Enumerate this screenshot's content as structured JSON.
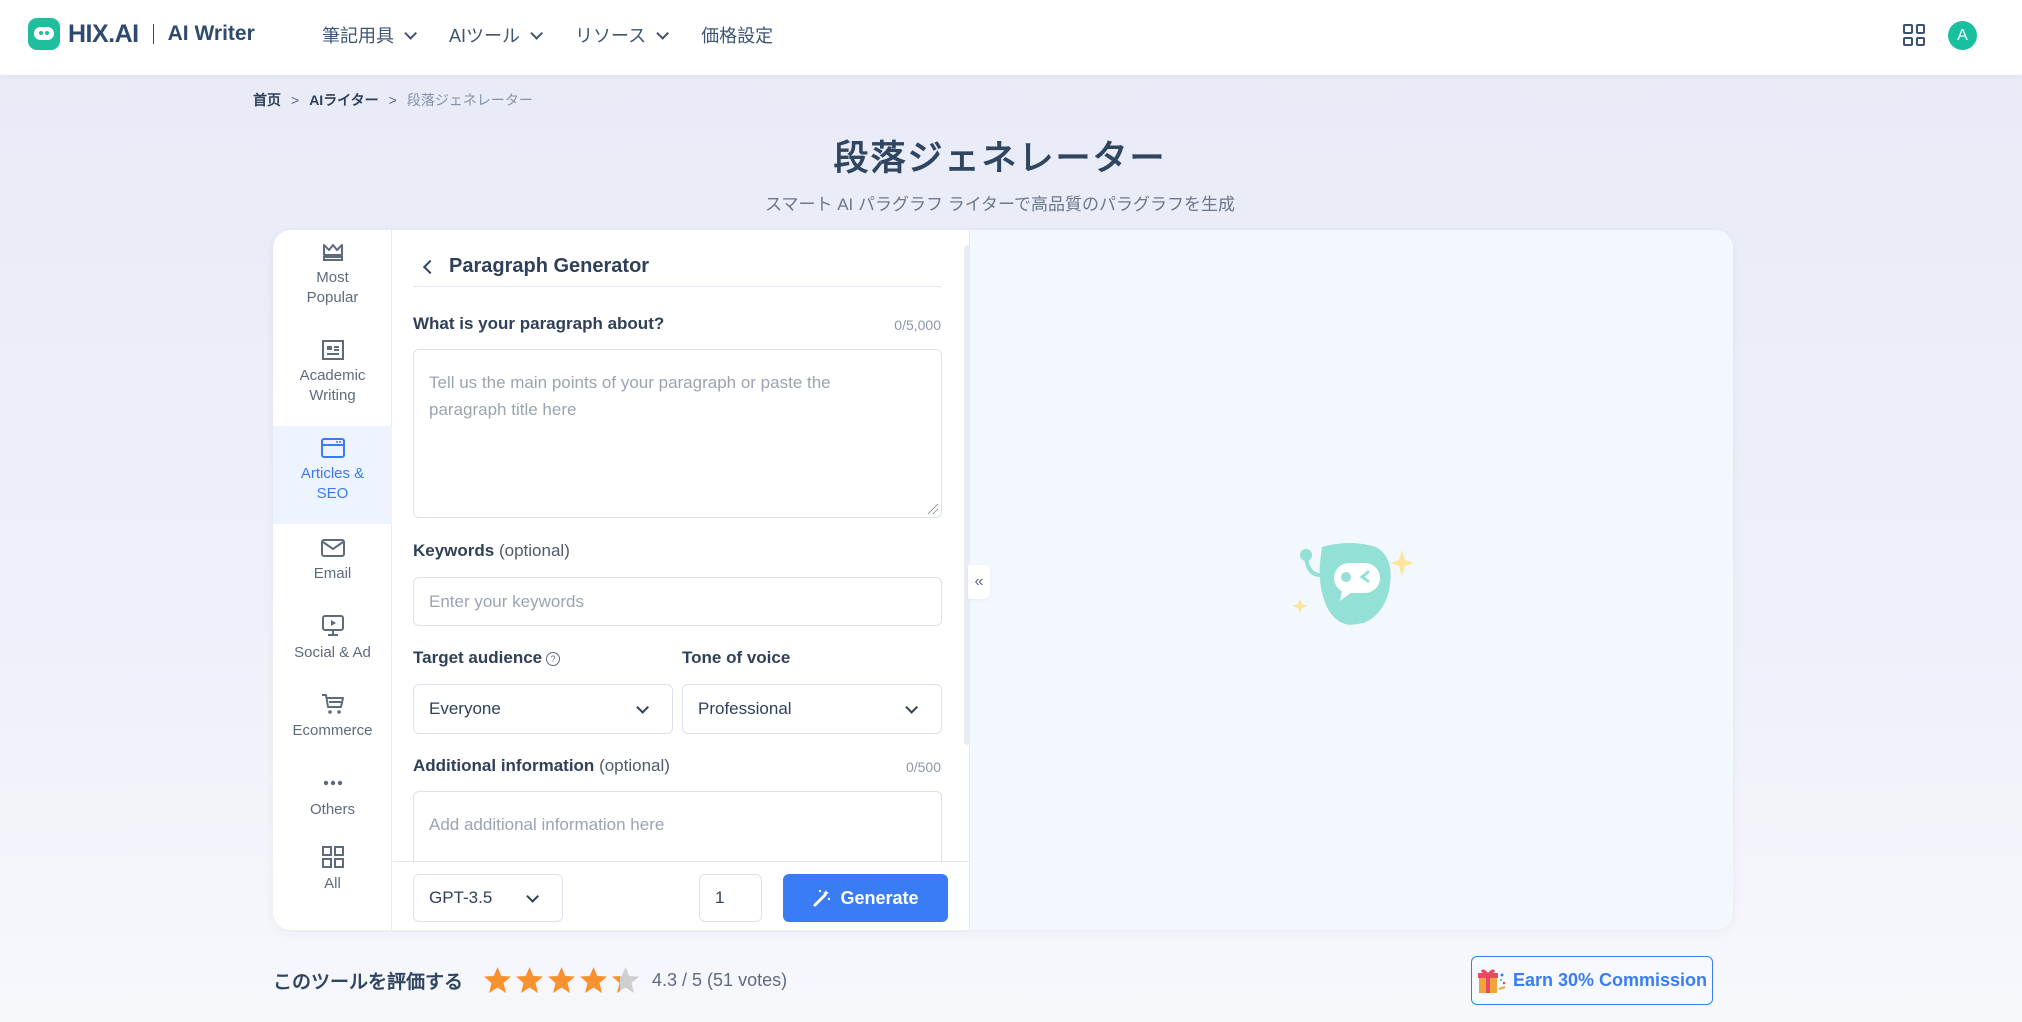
{
  "header": {
    "brand": "HIX.AI",
    "product": "AI Writer",
    "nav": [
      {
        "label": "筆記用具",
        "has_dropdown": true
      },
      {
        "label": "AIツール",
        "has_dropdown": true
      },
      {
        "label": "リソース",
        "has_dropdown": true
      },
      {
        "label": "価格設定",
        "has_dropdown": false
      }
    ],
    "apps_icon": "grid-icon",
    "avatar_letter": "A",
    "accent_color": "#18c09f"
  },
  "breadcrumb": {
    "items": [
      "首页",
      "AIライター",
      "段落ジェネレーター"
    ],
    "separator": ">"
  },
  "page": {
    "title": "段落ジェネレーター",
    "subtitle": "スマート AI パラグラフ ライターで高品質のパラグラフを生成"
  },
  "sidebar": {
    "items": [
      {
        "label": "Most Popular",
        "icon": "crown-icon",
        "active": false
      },
      {
        "label": "Academic Writing",
        "icon": "newspaper-icon",
        "active": false
      },
      {
        "label": "Articles & SEO",
        "icon": "browser-window-icon",
        "active": true
      },
      {
        "label": "Email",
        "icon": "mail-icon",
        "active": false
      },
      {
        "label": "Social & Ad",
        "icon": "monitor-play-icon",
        "active": false
      },
      {
        "label": "Ecommerce",
        "icon": "cart-icon",
        "active": false
      },
      {
        "label": "Others",
        "icon": "more-dots-icon",
        "active": false
      },
      {
        "label": "All",
        "icon": "grid-icon",
        "active": false
      }
    ]
  },
  "form": {
    "title": "Paragraph Generator",
    "topic": {
      "label": "What is your paragraph about?",
      "counter": "0/5,000",
      "placeholder": "Tell us the main points of your paragraph or paste the paragraph title here",
      "value": ""
    },
    "keywords": {
      "label": "Keywords",
      "optional": "(optional)",
      "placeholder": "Enter your keywords",
      "value": ""
    },
    "audience": {
      "label": "Target audience",
      "value": "Everyone"
    },
    "tone": {
      "label": "Tone of voice",
      "value": "Professional"
    },
    "additional": {
      "label": "Additional information",
      "optional": "(optional)",
      "counter": "0/500",
      "placeholder": "Add additional information here",
      "value": ""
    },
    "model": "GPT-3.5",
    "count": "1",
    "generate_label": "Generate",
    "generate_color": "#3a7cf6"
  },
  "rating": {
    "label": "このツールを評価する",
    "score": 4.3,
    "max": 5,
    "score_text": "4.3 / 5 (51 votes)"
  },
  "earn": {
    "label": "Earn 30% Commission"
  }
}
